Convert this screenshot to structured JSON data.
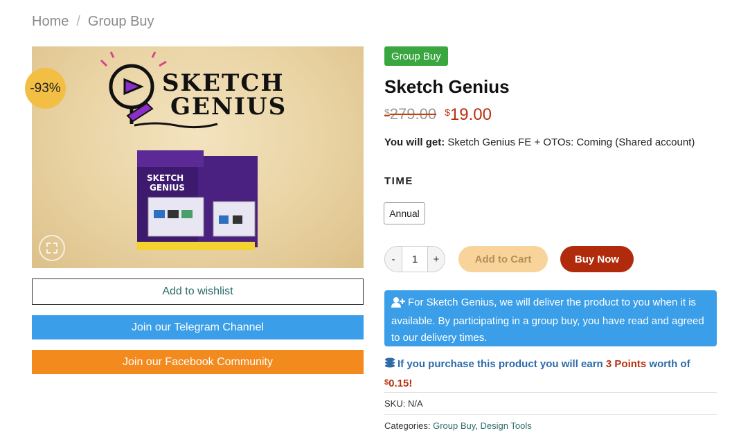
{
  "breadcrumb": {
    "home": "Home",
    "separator": "/",
    "current": "Group Buy"
  },
  "product": {
    "sale_badge": "-93%",
    "image_alt": "SKETCH GENIUS",
    "image_logo_line1": "SKETCH",
    "image_logo_line2": "GENIUS",
    "category_badge": "Group Buy",
    "title": "Sketch Genius",
    "currency": "$",
    "old_price": "279.00",
    "new_price": "19.00",
    "get_label": "You will get:",
    "get_value": "Sketch Genius FE + OTOs: Coming (Shared account)",
    "variation_label": "TIME",
    "variation_option": "Annual",
    "quantity": "1",
    "qty_minus": "-",
    "qty_plus": "+",
    "add_to_cart": "Add to Cart",
    "buy_now": "Buy Now"
  },
  "left_buttons": {
    "wishlist": "Add to wishlist",
    "telegram": "Join our Telegram Channel",
    "facebook": "Join our Facebook Community"
  },
  "notice": {
    "text": "For Sketch Genius, we will deliver the product to you when it is available. By participating in a group buy, you have read and agreed to our delivery times."
  },
  "points": {
    "prefix": "If you purchase this product you will earn",
    "points_value": "3 Points",
    "middle": "worth of",
    "currency": "$",
    "amount": "0.15",
    "suffix": "!"
  },
  "meta": {
    "sku_label": "SKU:",
    "sku_value": "N/A",
    "categories_label": "Categories:",
    "category_1": "Group Buy",
    "category_sep": ",",
    "category_2": "Design Tools"
  },
  "colors": {
    "accent_green": "#3aa640",
    "price_red": "#b9300f",
    "telegram_blue": "#3a9ee8",
    "facebook_orange": "#f28a1e",
    "buy_now": "#b02a0c",
    "add_to_cart_bg": "#f9d49a",
    "sale_badge": "#f2be44"
  },
  "icons": {
    "zoom": "zoom-expand-icon",
    "notice": "user-plus-icon",
    "points": "coins-icon"
  }
}
